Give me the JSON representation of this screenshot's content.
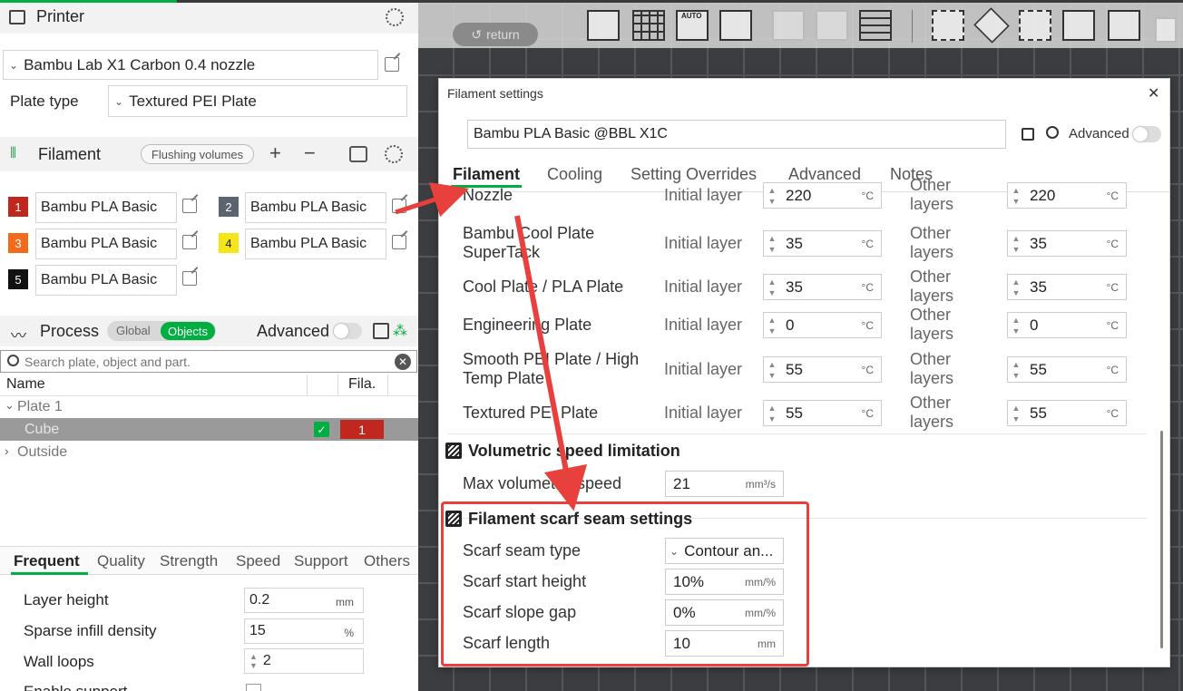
{
  "printer": {
    "title": "Printer",
    "preset": "Bambu Lab X1 Carbon 0.4 nozzle",
    "plate_type_label": "Plate type",
    "plate_type": "Textured PEI Plate"
  },
  "filament": {
    "title": "Filament",
    "flushing": "Flushing volumes",
    "plus": "+",
    "minus": "−",
    "slots": [
      {
        "num": "1",
        "name": "Bambu PLA Basic",
        "color": "#c0281f",
        "textcolor": "#ffffff"
      },
      {
        "num": "2",
        "name": "Bambu PLA Basic",
        "color": "#5c6470",
        "textcolor": "#ffffff"
      },
      {
        "num": "3",
        "name": "Bambu PLA Basic",
        "color": "#f26a1c",
        "textcolor": "#ffffff"
      },
      {
        "num": "4",
        "name": "Bambu PLA Basic",
        "color": "#f5e61a",
        "textcolor": "#222222"
      },
      {
        "num": "5",
        "name": "Bambu PLA Basic",
        "color": "#111111",
        "textcolor": "#ffffff"
      }
    ]
  },
  "process": {
    "title": "Process",
    "global": "Global",
    "objects": "Objects",
    "advanced": "Advanced",
    "search_placeholder": "Search plate, object and part.",
    "col_name": "Name",
    "col_fila": "Fila.",
    "plate": "Plate 1",
    "cube": "Cube",
    "cube_fila": "1",
    "outside": "Outside"
  },
  "proc_tabs": [
    "Frequent",
    "Quality",
    "Strength",
    "Speed",
    "Support",
    "Others"
  ],
  "proc_rows": [
    {
      "label": "Layer height",
      "value": "0.2",
      "unit": "mm"
    },
    {
      "label": "Sparse infill density",
      "value": "15",
      "unit": "%"
    },
    {
      "label": "Wall loops",
      "value": "2",
      "unit": ""
    },
    {
      "label": "Enable support",
      "value": "",
      "unit": ""
    }
  ],
  "viewport": {
    "return": "return",
    "auto": "AUTO"
  },
  "dialog": {
    "title": "Filament settings",
    "close": "✕",
    "preset": "Bambu PLA Basic @BBL X1C",
    "advanced": "Advanced",
    "tabs": [
      "Filament",
      "Cooling",
      "Setting Overrides",
      "Advanced",
      "Notes"
    ],
    "initial_label": "Initial layer",
    "other_label": "Other layers",
    "temp_unit": "°C",
    "plates": [
      {
        "name": "Nozzle",
        "init": "220",
        "other": "220",
        "other_label": "Other layers"
      },
      {
        "name": "Bambu Cool Plate SuperTack",
        "init": "35",
        "other": "35"
      },
      {
        "name": "Cool Plate / PLA Plate",
        "init": "35",
        "other": "35"
      },
      {
        "name": "Engineering Plate",
        "init": "0",
        "other": "0"
      },
      {
        "name": "Smooth PEI Plate / High Temp Plate",
        "init": "55",
        "other": "55"
      },
      {
        "name": "Textured PEI Plate",
        "init": "55",
        "other": "55"
      }
    ],
    "vol_group": "Volumetric speed limitation",
    "vol_label": "Max volumetric speed",
    "vol_value": "21",
    "vol_unit": "mm³/s",
    "scarf_group": "Filament scarf seam settings",
    "scarf_type_label": "Scarf seam type",
    "scarf_type_value": "Contour an...",
    "scarf_height_label": "Scarf start height",
    "scarf_height_value": "10%",
    "scarf_height_unit": "mm/%",
    "scarf_gap_label": "Scarf slope gap",
    "scarf_gap_value": "0%",
    "scarf_gap_unit": "mm/%",
    "scarf_len_label": "Scarf length",
    "scarf_len_value": "10",
    "scarf_len_unit": "mm"
  },
  "colors": {
    "accent": "#00ae42",
    "highlight": "#e8413d"
  }
}
